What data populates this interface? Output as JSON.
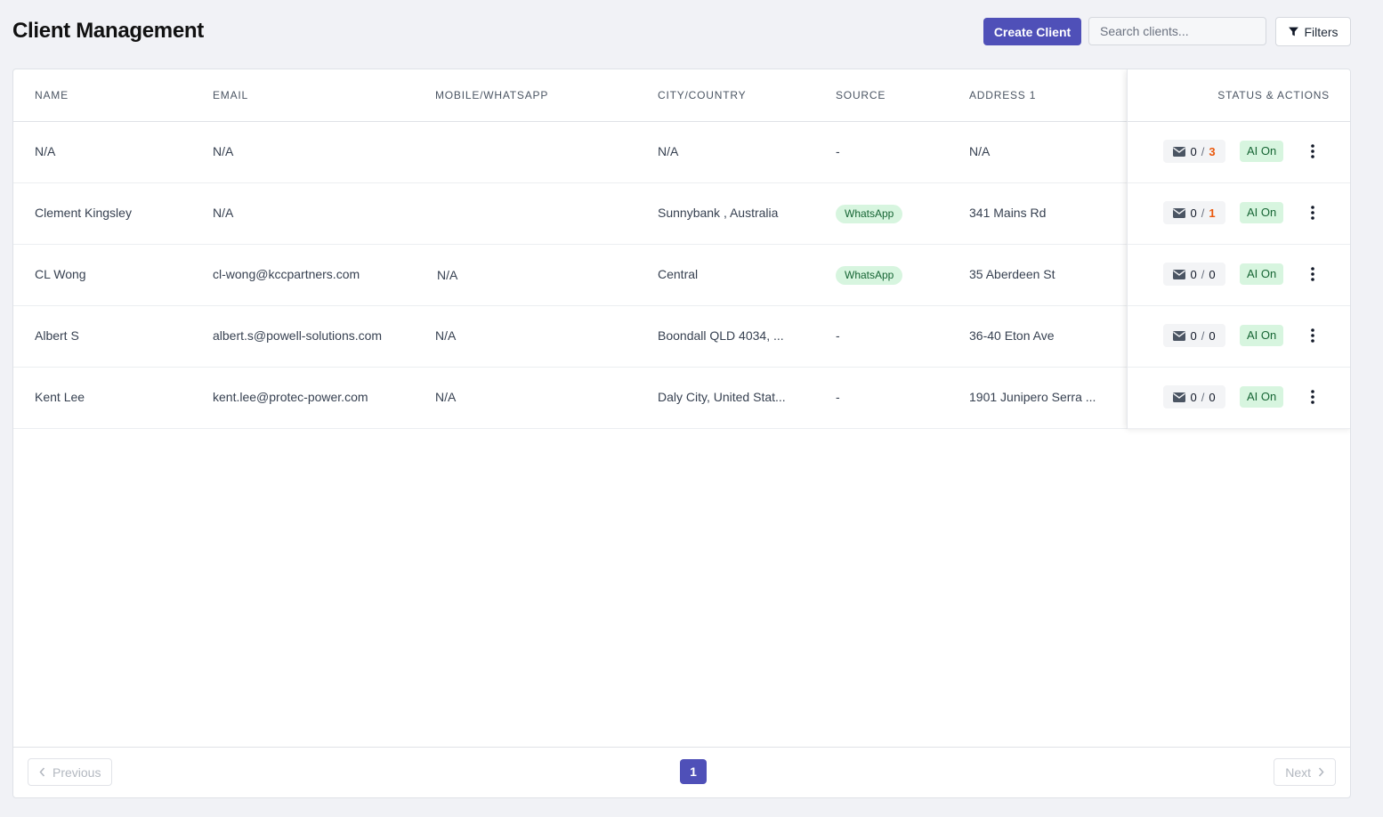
{
  "header": {
    "title": "Client Management",
    "create_label": "Create Client",
    "search_placeholder": "Search clients...",
    "filters_label": "Filters"
  },
  "table": {
    "columns": [
      "NAME",
      "EMAIL",
      "MOBILE/WHATSAPP",
      "CITY/COUNTRY",
      "SOURCE",
      "ADDRESS 1"
    ],
    "actions_header": "STATUS & ACTIONS",
    "rows": [
      {
        "name": "N/A",
        "email": "N/A",
        "mobile": "",
        "city": "N/A",
        "source": "-",
        "address": "N/A",
        "messages_read": "0",
        "messages_total": "3",
        "ai": "AI On"
      },
      {
        "name": "Clement Kingsley",
        "email": "N/A",
        "mobile": "",
        "city": "Sunnybank , Australia",
        "source_badge": "WhatsApp",
        "address": "341 Mains Rd",
        "messages_read": "0",
        "messages_total": "1",
        "ai": "AI On"
      },
      {
        "name": "CL Wong",
        "email": "cl-wong@kccpartners.com",
        "mobile": "N/A",
        "city": "Central",
        "source_badge": "WhatsApp",
        "address": "35 Aberdeen St",
        "messages_read": "0",
        "messages_total": "0",
        "ai": "AI On"
      },
      {
        "name": "Albert S",
        "email": "albert.s@powell-solutions.com",
        "mobile": "N/A",
        "city": "Boondall QLD 4034, ...",
        "source": "-",
        "address": "36-40 Eton Ave",
        "messages_read": "0",
        "messages_total": "0",
        "ai": "AI On"
      },
      {
        "name": "Kent Lee",
        "email": "kent.lee@protec-power.com",
        "mobile": "N/A",
        "city": "Daly City, United Stat...",
        "source": "-",
        "address": "1901 Junipero Serra ...",
        "messages_read": "0",
        "messages_total": "0",
        "ai": "AI On"
      }
    ]
  },
  "pagination": {
    "previous": "Previous",
    "current_page": "1",
    "next": "Next"
  },
  "colors": {
    "primary": "#4f50b8",
    "alert": "#ea580c",
    "badge_bg": "#d7f5df",
    "badge_text": "#166534"
  }
}
